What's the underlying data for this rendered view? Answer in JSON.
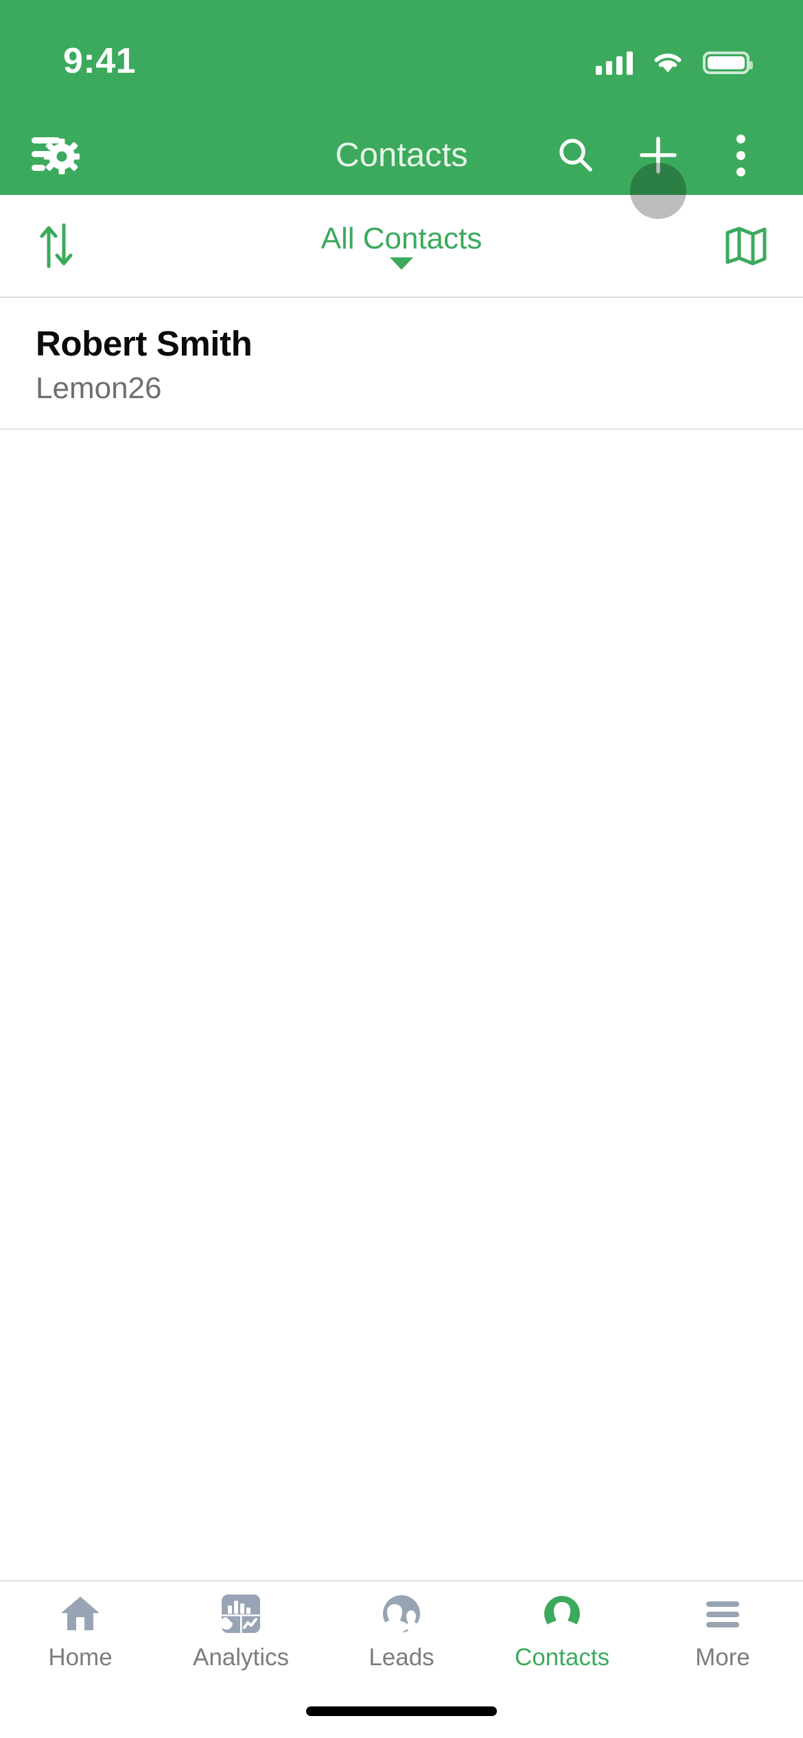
{
  "status_bar": {
    "time": "9:41",
    "signal_icon": "cellular-signal-icon",
    "wifi_icon": "wifi-icon",
    "battery_icon": "battery-icon"
  },
  "app_bar": {
    "title": "Contacts",
    "filter_settings_icon": "filter-settings-icon",
    "search_icon": "search-icon",
    "add_icon": "plus-icon",
    "overflow_icon": "more-vertical-icon",
    "background_color": "#3BAA5C",
    "title_color": "#E7F6EA"
  },
  "filter_bar": {
    "sort_icon": "sort-arrows-icon",
    "selected_view": "All Contacts",
    "dropdown_icon": "chevron-down-icon",
    "map_icon": "map-icon",
    "accent_color": "#3BAA5C"
  },
  "contacts": [
    {
      "name": "Robert Smith",
      "subtitle": "Lemon26"
    }
  ],
  "tab_bar": {
    "active_index": 3,
    "active_color": "#3BAA5C",
    "inactive_color": "#7C7C7C",
    "items": [
      {
        "label": "Home",
        "icon": "home-icon"
      },
      {
        "label": "Analytics",
        "icon": "analytics-dashboard-icon"
      },
      {
        "label": "Leads",
        "icon": "leads-people-icon"
      },
      {
        "label": "Contacts",
        "icon": "contact-person-icon"
      },
      {
        "label": "More",
        "icon": "hamburger-menu-icon"
      }
    ]
  }
}
